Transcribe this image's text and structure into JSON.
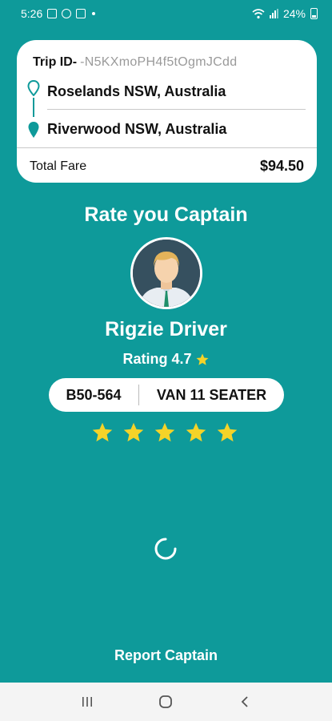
{
  "status_bar": {
    "time": "5:26",
    "battery": "24%"
  },
  "trip": {
    "id_label": "Trip ID-",
    "id_value": "-N5KXmoPH4f5tOgmJCdd",
    "from": "Roselands NSW, Australia",
    "to": "Riverwood NSW, Australia",
    "fare_label": "Total Fare",
    "fare_value": "$94.50"
  },
  "rate_title": "Rate you Captain",
  "driver": {
    "name": "Rigzie Driver",
    "rating_text": "Rating 4.7",
    "plate": "B50-564",
    "vehicle_type": "VAN 11 SEATER"
  },
  "rating_stars": {
    "count": 5,
    "selected": 5
  },
  "colors": {
    "background": "#0e9a9a",
    "star": "#f5d328",
    "card": "#ffffff"
  },
  "report_label": "Report Captain",
  "nav": {
    "recents": "recents-icon",
    "home": "home-icon",
    "back": "back-icon"
  }
}
